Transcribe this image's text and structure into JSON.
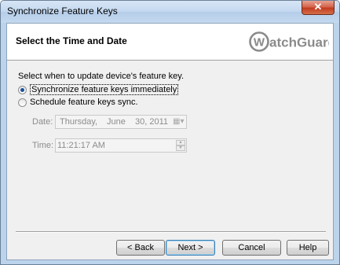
{
  "window": {
    "title": "Synchronize Feature Keys",
    "close_glyph": "✕"
  },
  "header": {
    "title": "Select the Time and Date",
    "logo_text": "atchGuard",
    "logo_letter": "W"
  },
  "content": {
    "prompt": "Select when to update device's feature key.",
    "options": [
      {
        "label": "Synchronize feature keys immediately",
        "checked": true
      },
      {
        "label": "Schedule feature keys sync.",
        "checked": false
      }
    ],
    "date": {
      "label": "Date:",
      "weekday": "Thursday",
      "sep": ",",
      "month": "June",
      "day_year": "30, 2011"
    },
    "time": {
      "label": "Time:",
      "value": "11:21:17 AM"
    }
  },
  "buttons": {
    "back": "< Back",
    "next": "Next >",
    "cancel": "Cancel",
    "help": "Help"
  },
  "colors": {
    "accent": "#3c7fb1",
    "logo": "#8a8a8a",
    "close": "#c23b1f"
  },
  "icons": {
    "close": "close-icon",
    "calendar": "calendar-icon",
    "spin_up": "spin-up-icon",
    "spin_down": "spin-down-icon"
  }
}
